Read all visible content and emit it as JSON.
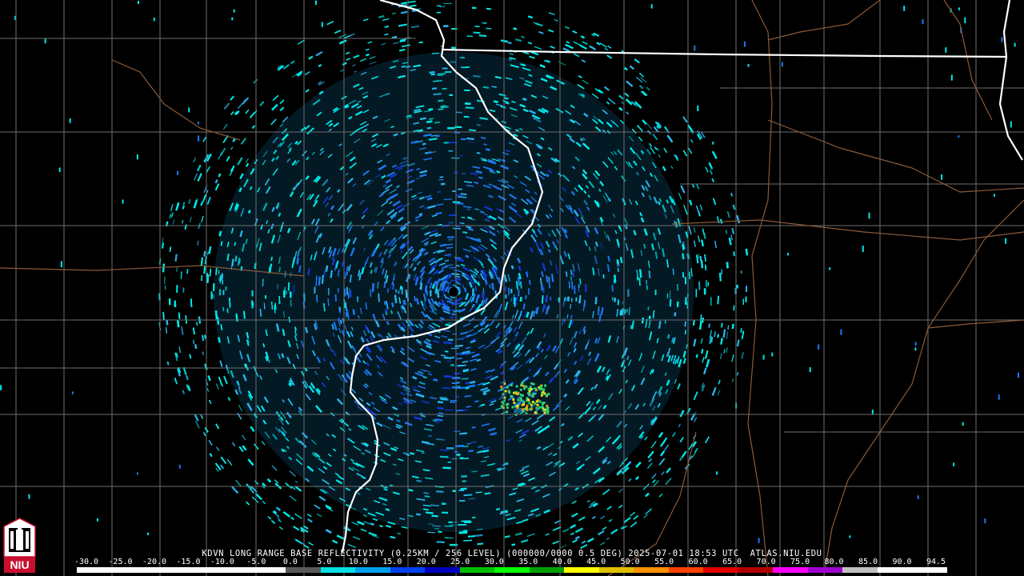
{
  "map": {
    "radar_site": "KDVN",
    "product": "LONG RANGE BASE REFLECTIVITY",
    "caption": "KDVN LONG RANGE BASE REFLECTIVITY (0.25KM / 256 LEVEL) (000000/0000 0.5 DEG) 2025-07-01 18:53 UTC  ATLAS.NIU.EDU",
    "logo_text": "NIU",
    "background_color": "#000000",
    "county_line_color": "#6e6e6e",
    "state_line_color": "#ffffff",
    "highway_color": "#8a5a3a",
    "echo_colors": [
      "#00e8e8",
      "#28b4ec",
      "#1e78f0",
      "#1438d8",
      "#2ad070",
      "#e8e020",
      "#e89020"
    ]
  },
  "scale": {
    "labels": [
      "-30.0",
      "-25.0",
      "-20.0",
      "-15.0",
      "-10.0",
      "-5.0",
      "0.0",
      "5.0",
      "10.0",
      "15.0",
      "20.0",
      "25.0",
      "30.0",
      "35.0",
      "40.0",
      "45.0",
      "50.0",
      "55.0",
      "60.0",
      "65.0",
      "70.0",
      "75.0",
      "80.0",
      "85.0",
      "90.0",
      "94.5"
    ],
    "colors": [
      "#ffffff",
      "#ffffff",
      "#ffffff",
      "#ffffff",
      "#ffffff",
      "#ffffff",
      "#5a5a5a",
      "#00e0e0",
      "#00a0f0",
      "#0040f0",
      "#0000c0",
      "#00c000",
      "#00ff00",
      "#00a000",
      "#ffff00",
      "#e0c000",
      "#ff9000",
      "#ff4000",
      "#e00000",
      "#b00000",
      "#ff00ff",
      "#a000d0",
      "#c0c0c0",
      "#ffffff",
      "#ffffff"
    ]
  }
}
